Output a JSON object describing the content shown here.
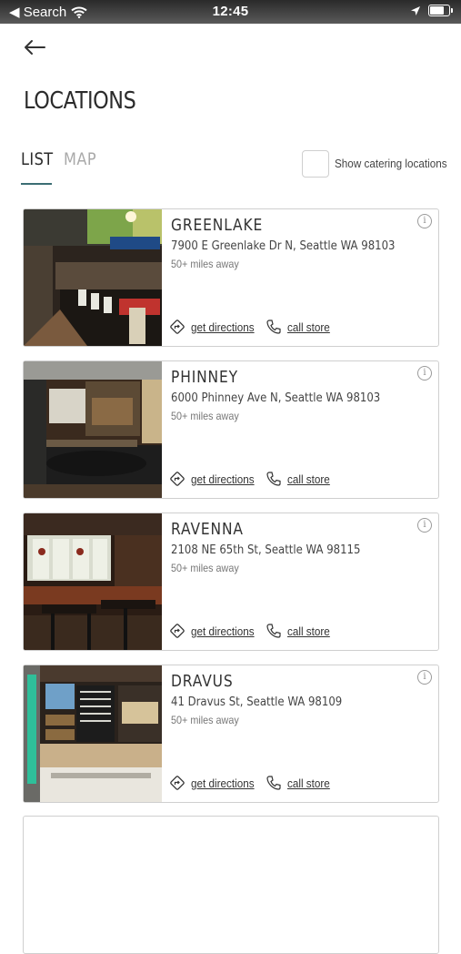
{
  "status_bar": {
    "back_label": "◀ Search",
    "time": "12:45",
    "battery_level": 0.85
  },
  "page": {
    "title": "LOCATIONS",
    "tabs": [
      {
        "label": "LIST",
        "active": true
      },
      {
        "label": "MAP",
        "active": false
      }
    ],
    "catering_label": "Show catering locations",
    "catering_checked": false
  },
  "locations": [
    {
      "name": "GREENLAKE",
      "address": "7900 E Greenlake Dr N, Seattle WA 98103",
      "distance": "50+ miles away",
      "directions_label": "get directions",
      "call_label": "call store"
    },
    {
      "name": "PHINNEY",
      "address": "6000 Phinney Ave N, Seattle WA 98103",
      "distance": "50+ miles away",
      "directions_label": "get directions",
      "call_label": "call store"
    },
    {
      "name": "RAVENNA",
      "address": "2108 NE 65th St, Seattle WA 98115",
      "distance": "50+ miles away",
      "directions_label": "get directions",
      "call_label": "call store"
    },
    {
      "name": "DRAVUS",
      "address": "41 Dravus St, Seattle WA 98109",
      "distance": "50+ miles away",
      "directions_label": "get directions",
      "call_label": "call store"
    }
  ],
  "colors": {
    "accent": "#3c6e74",
    "inactive_tab": "#a9a9a9",
    "card_border": "#cfcfcf"
  },
  "icons": {
    "back": "arrow-left-icon",
    "info": "info-icon",
    "directions": "directions-icon",
    "call": "phone-icon"
  }
}
